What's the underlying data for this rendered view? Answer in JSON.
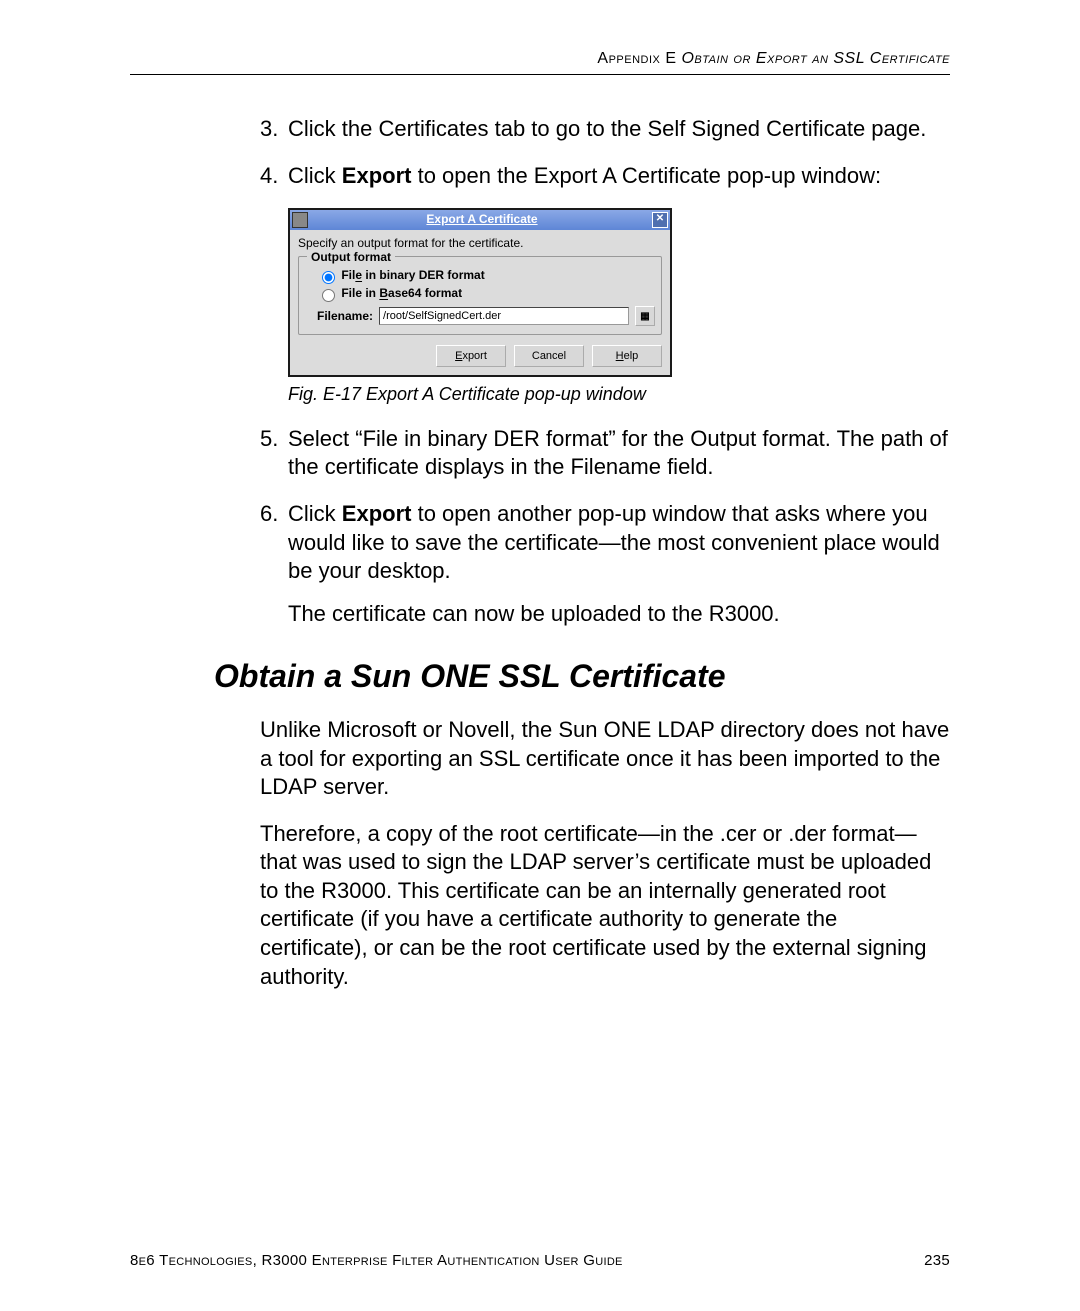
{
  "header": {
    "prefix": "Appendix E  ",
    "title_italic": "Obtain or Export an SSL Certificate"
  },
  "steps_a": [
    {
      "num": "3.",
      "html": "Click the Certificates tab to go to the Self Signed Certificate page."
    },
    {
      "num": "4.",
      "html_pre": "Click ",
      "bold": "Export",
      "html_post": " to open the Export A Certificate pop-up window:"
    }
  ],
  "dialog": {
    "title": "Export A Certificate",
    "instruction": "Specify an output format for the certificate.",
    "legend": "Output format",
    "radio1_prefix": "Fil",
    "radio1_ul": "e",
    "radio1_suffix": " in binary DER format",
    "radio2_prefix": "File in ",
    "radio2_ul": "B",
    "radio2_suffix": "ase64 format",
    "filename_label": "Filename:",
    "filename_value": "/root/SelfSignedCert.der",
    "btn_export_ul": "E",
    "btn_export_rest": "xport",
    "btn_cancel": "Cancel",
    "btn_help_ul": "H",
    "btn_help_rest": "elp"
  },
  "caption": "Fig. E-17  Export A Certificate pop-up window",
  "steps_b": [
    {
      "num": "5.",
      "html": "Select “File in binary DER format” for the Output format. The path of the certificate displays in the Filename field."
    },
    {
      "num": "6.",
      "html_pre": "Click ",
      "bold": "Export",
      "html_post": " to open another pop-up window that asks where you would like to save the certificate—the most convenient place would be your desktop."
    }
  ],
  "after6": "The certificate can now be uploaded to the R3000.",
  "section_title": "Obtain a Sun ONE SSL Certificate",
  "paras": [
    "Unlike Microsoft or Novell, the Sun ONE LDAP directory does not have a tool for exporting an SSL certificate once it has been imported to the LDAP server.",
    "Therefore, a copy of the root certificate—in the .cer or .der format—that was used to sign the LDAP server’s certificate must be uploaded to the R3000. This certificate can be an internally generated root certificate (if you have a certificate authority to generate the certificate), or can be the root certificate used by the external signing authority."
  ],
  "footer": {
    "text": "8e6 Technologies, R3000 Enterprise Filter Authentication User Guide",
    "page": "235"
  }
}
